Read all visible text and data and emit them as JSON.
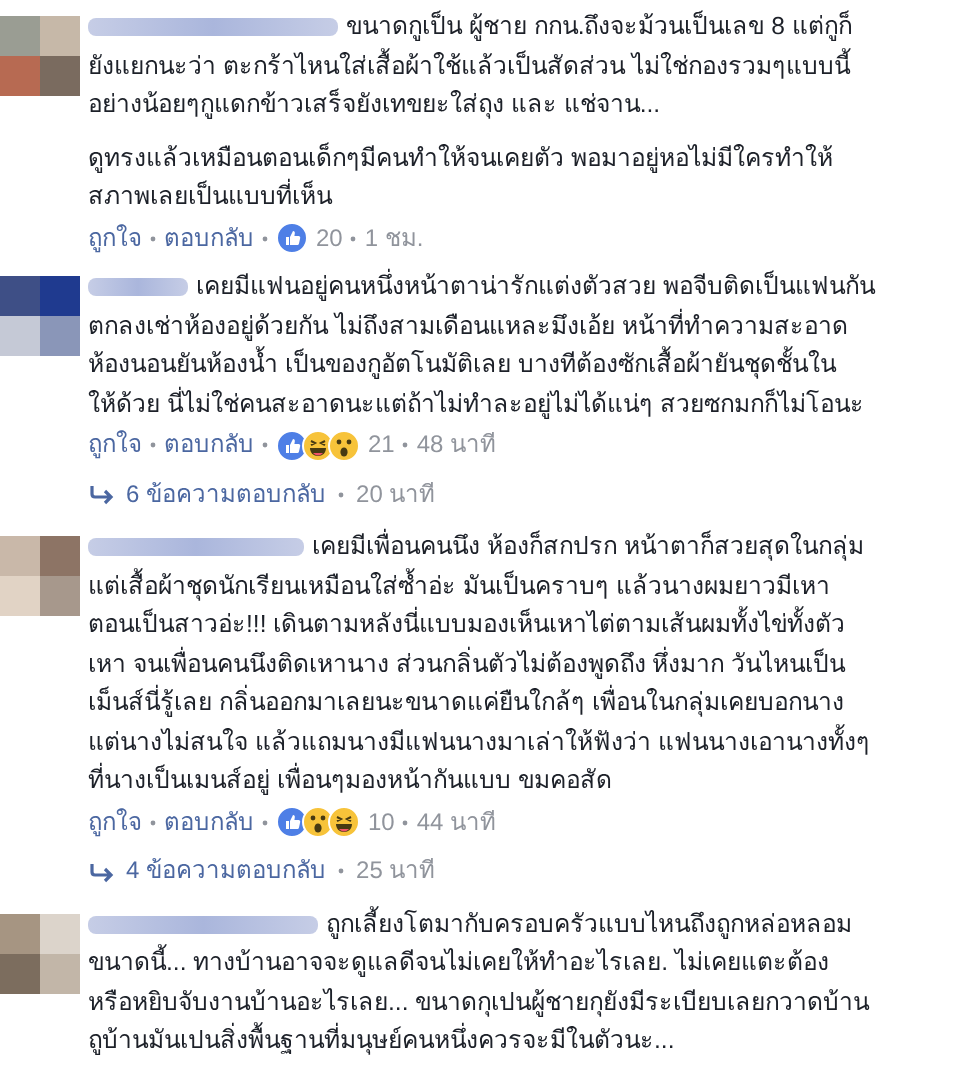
{
  "comments": [
    {
      "lead": "ขนาดกูเป็น ผู้ชาย กกน.ถึงจะม้วนเป็นเลข 8 แต่กูก็",
      "paragraphs": [
        "ยังแยกนะว่า ตะกร้าไหนใส่เสื้อผ้าใช้แล้วเป็นสัดส่วน ไม่ใช่กองรวมๆแบบนี้\nอย่างน้อยๆกูแดกข้าวเสร็จยังเทขยะใส่ถุง และ แช่จาน...",
        "ดูทรงแล้วเหมือนตอนเด็กๆมีคนทำให้จนเคยตัว พอมาอยู่หอไม่มีใครทำให้\nสภาพเลยเป็นแบบที่เห็น"
      ],
      "like_label": "ถูกใจ",
      "reply_label": "ตอบกลับ",
      "reactions": [
        {
          "kind": "like"
        }
      ],
      "count": "20",
      "time": "1 ชม."
    },
    {
      "lead": "เคยมีแฟนอยู่คนหนึ่งหน้าตาน่ารักแต่งตัวสวย พอจีบติดเป็นแฟนกัน",
      "paragraphs": [
        "ตกลงเช่าห้องอยู่ด้วยกัน ไม่ถึงสามเดือนแหละมึงเอ้ย หน้าที่ทำความสะอาด\nห้องนอนยันห้องน้ำ เป็นของกูอัตโนมัติเลย บางทีต้องซักเสื้อผ้ายันชุดชั้นใน\nให้ด้วย นี่ไม่ใช่คนสะอาดนะแต่ถ้าไม่ทำละอยู่ไม่ได้แน่ๆ สวยซกมกก็ไม่โอนะ"
      ],
      "like_label": "ถูกใจ",
      "reply_label": "ตอบกลับ",
      "reactions": [
        {
          "kind": "like"
        },
        {
          "kind": "haha"
        },
        {
          "kind": "wow"
        }
      ],
      "count": "21",
      "time": "48 นาที",
      "replies": {
        "label": "6 ข้อความตอบกลับ",
        "time": "20 นาที"
      }
    },
    {
      "lead": "เคยมีเพื่อนคนนึง ห้องก็สกปรก หน้าตาก็สวยสุดในกลุ่ม",
      "paragraphs": [
        "แต่เสื้อผ้าชุดนักเรียนเหมือนใส่ซ้ำอ่ะ มันเป็นคราบๆ แล้วนางผมยาวมีเหา\nตอนเป็นสาวอ่ะ!!! เดินตามหลังนี่แบบมองเห็นเหาไต่ตามเส้นผมทั้งไข่ทั้งตัว\nเหา จนเพื่อนคนนึงติดเหานาง ส่วนกลิ่นตัวไม่ต้องพูดถึง หึ่งมาก วันไหนเป็น\nเม็นส์นี่รู้เลย กลิ่นออกมาเลยนะขนาดแค่ยืนใกล้ๆ เพื่อนในกลุ่มเคยบอกนาง\nแต่นางไม่สนใจ แล้วแถมนางมีแฟนนางมาเล่าให้ฟังว่า แฟนนางเอานางทั้งๆ\nที่นางเป็นเมนส์อยู่ เพื่อนๆมองหน้ากันแบบ ขมคอสัด"
      ],
      "like_label": "ถูกใจ",
      "reply_label": "ตอบกลับ",
      "reactions": [
        {
          "kind": "like"
        },
        {
          "kind": "wow"
        },
        {
          "kind": "haha"
        }
      ],
      "count": "10",
      "time": "44 นาที",
      "replies": {
        "label": "4 ข้อความตอบกลับ",
        "time": "25 นาที"
      }
    },
    {
      "lead": "ถูกเลี้ยงโตมากับครอบครัวแบบไหนถึงถูกหล่อหลอม",
      "paragraphs": [
        "ขนาดนี้... ทางบ้านอาจจะดูแลดีจนไม่เคยให้ทำอะไรเลย. ไม่เคยแตะต้อง\nหรือหยิบจับงานบ้านอะไรเลย... ขนาดกุเปนผู้ชายกุยังมีระเบียบเลยกวาดบ้าน\nถูบ้านมันเปนสิ่งพื้นฐานที่มนุษย์คนหนึ่งควรจะมีในตัวนะ..."
      ]
    }
  ]
}
